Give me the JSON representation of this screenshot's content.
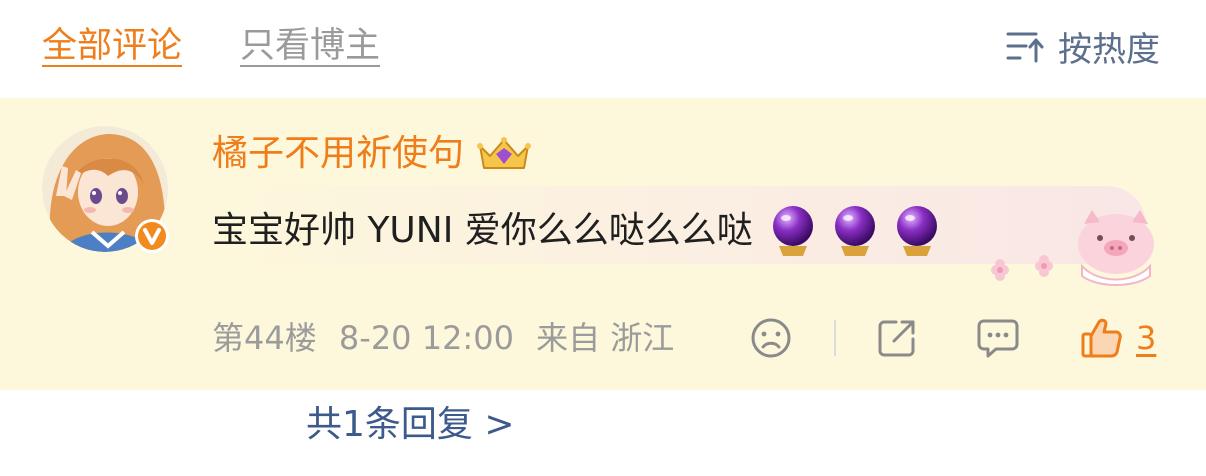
{
  "tabs": {
    "all": "全部评论",
    "blogger_only": "只看博主",
    "sort_label": "按热度",
    "sort_icon": "sort-icon"
  },
  "comment": {
    "username": "橘子不用祈使句",
    "badge_icon": "crown-icon",
    "verified_icon": "verified-v-icon",
    "text": "宝宝好帅 YUNI 爱你么么哒么么哒",
    "emoji_icons": [
      "crystal-ball-icon",
      "crystal-ball-icon",
      "crystal-ball-icon"
    ],
    "floor": "第44楼",
    "time": "8-20 12:00",
    "location": "来自 浙江",
    "like_count": "3",
    "colors": {
      "accent": "#ef7d1a",
      "card_bg": "#fdf8dc",
      "link": "#3d5a8c",
      "meta": "#9b9b9b"
    }
  },
  "replies": {
    "label": "共1条回复 >"
  }
}
